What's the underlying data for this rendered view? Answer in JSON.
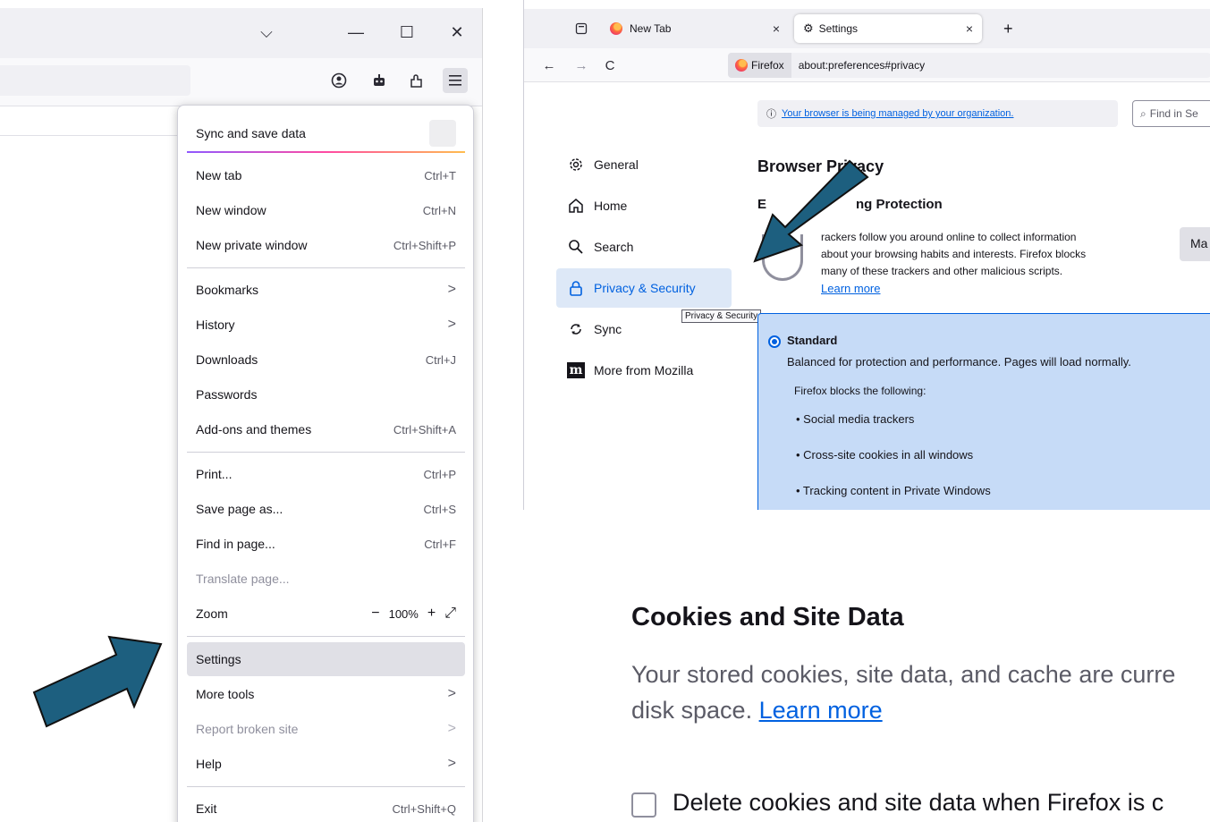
{
  "left_window": {
    "controls": {
      "list_all_tabs": "⌵",
      "minimize": "—",
      "maximize": "☐",
      "close": "✕"
    },
    "app_menu": {
      "sync_label": "Sync and save data",
      "new_tab": {
        "label": "New tab",
        "shortcut": "Ctrl+T"
      },
      "new_window": {
        "label": "New window",
        "shortcut": "Ctrl+N"
      },
      "new_private_window": {
        "label": "New private window",
        "shortcut": "Ctrl+Shift+P"
      },
      "bookmarks": {
        "label": "Bookmarks"
      },
      "history": {
        "label": "History"
      },
      "downloads": {
        "label": "Downloads",
        "shortcut": "Ctrl+J"
      },
      "passwords": {
        "label": "Passwords"
      },
      "addons": {
        "label": "Add-ons and themes",
        "shortcut": "Ctrl+Shift+A"
      },
      "print": {
        "label": "Print...",
        "shortcut": "Ctrl+P"
      },
      "save_page": {
        "label": "Save page as...",
        "shortcut": "Ctrl+S"
      },
      "find_in_page": {
        "label": "Find in page...",
        "shortcut": "Ctrl+F"
      },
      "translate": {
        "label": "Translate page..."
      },
      "zoom": {
        "label": "Zoom",
        "minus": "−",
        "level": "100%",
        "plus": "+",
        "fullscreen": "⤢"
      },
      "settings": {
        "label": "Settings"
      },
      "more_tools": {
        "label": "More tools"
      },
      "report_broken": {
        "label": "Report broken site"
      },
      "help": {
        "label": "Help"
      },
      "exit": {
        "label": "Exit",
        "shortcut": "Ctrl+Shift+Q"
      }
    }
  },
  "right_window": {
    "tabs": [
      {
        "label": "New Tab",
        "close": "×"
      },
      {
        "label": "Settings",
        "close": "×"
      }
    ],
    "new_tab_button": "+",
    "nav": {
      "back": "←",
      "forward": "→",
      "reload": "C"
    },
    "urlbar": {
      "identity": "Firefox",
      "url": "about:preferences#privacy"
    },
    "managed_notice": {
      "icon": "ⓘ",
      "text": "Your browser is being managed by your organization."
    },
    "find_placeholder": "Find in Se",
    "categories": [
      {
        "label": "General",
        "icon": "gear-icon"
      },
      {
        "label": "Home",
        "icon": "home-icon"
      },
      {
        "label": "Search",
        "icon": "search-icon"
      },
      {
        "label": "Privacy & Security",
        "icon": "lock-icon"
      },
      {
        "label": "Sync",
        "icon": "sync-icon"
      },
      {
        "label": "More from Mozilla",
        "icon": "mozilla-m-icon",
        "icon_text": "m"
      }
    ],
    "tooltip": "Privacy & Security",
    "browser_privacy": {
      "title": "Browser Privacy",
      "etp_title_start": "E",
      "etp_title_end": "ng Protection",
      "etp_desc_lines": [
        "rackers follow you around online to collect information",
        "about your browsing habits and interests. Firefox blocks",
        "many of these trackers and other malicious scripts."
      ],
      "learn_more": "Learn more",
      "manage_button": "Ma"
    },
    "standard": {
      "label": "Standard",
      "description": "Balanced for protection and performance. Pages will load normally.",
      "blocks_heading": "Firefox blocks the following:",
      "items": [
        "• Social media trackers",
        "• Cross-site cookies in all windows",
        "• Tracking content in Private Windows"
      ]
    }
  },
  "cookies": {
    "title": "Cookies and Site Data",
    "description_line1": "Your stored cookies, site data, and cache are curre",
    "description_line2_prefix": "disk space. ",
    "learn_more": "Learn more",
    "delete_label": "Delete cookies and site data when Firefox is c",
    "delete_checked": false
  },
  "colors": {
    "accent": "#0061e0",
    "arrow_fill": "#1d5f7f",
    "arrow_stroke": "#111111",
    "selected_bg": "#c6dbf7"
  }
}
